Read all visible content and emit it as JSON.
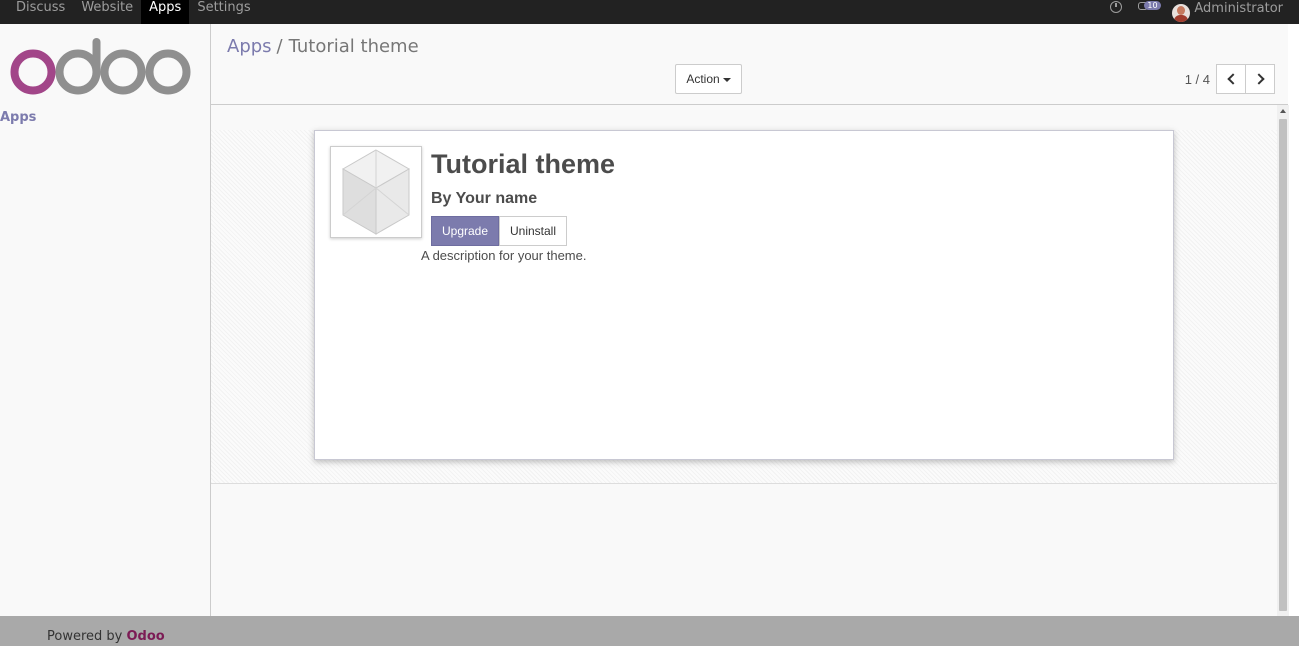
{
  "topbar": {
    "menu": [
      {
        "label": "Discuss"
      },
      {
        "label": "Website"
      },
      {
        "label": "Apps"
      },
      {
        "label": "Settings"
      }
    ],
    "active_menu": "Apps",
    "messages_badge": "10",
    "user_name": "Administrator",
    "icons": [
      "clock-icon",
      "chat-icon",
      "avatar"
    ]
  },
  "sidebar": {
    "logo_text": "odoo",
    "apps_link": "Apps"
  },
  "control": {
    "breadcrumb": {
      "parent": "Apps",
      "separator": "/",
      "current": "Tutorial theme"
    },
    "action_label": "Action",
    "pager": {
      "count": "1 / 4"
    }
  },
  "app": {
    "title": "Tutorial theme",
    "author": "By Your name",
    "upgrade_label": "Upgrade",
    "uninstall_label": "Uninstall",
    "description": "A description for your theme."
  },
  "footer": {
    "powered_prefix": "Powered by",
    "brand": "Odoo"
  },
  "colors": {
    "accent": "#7c7bad",
    "topbar": "#222222",
    "brand": "#7c1b55"
  }
}
